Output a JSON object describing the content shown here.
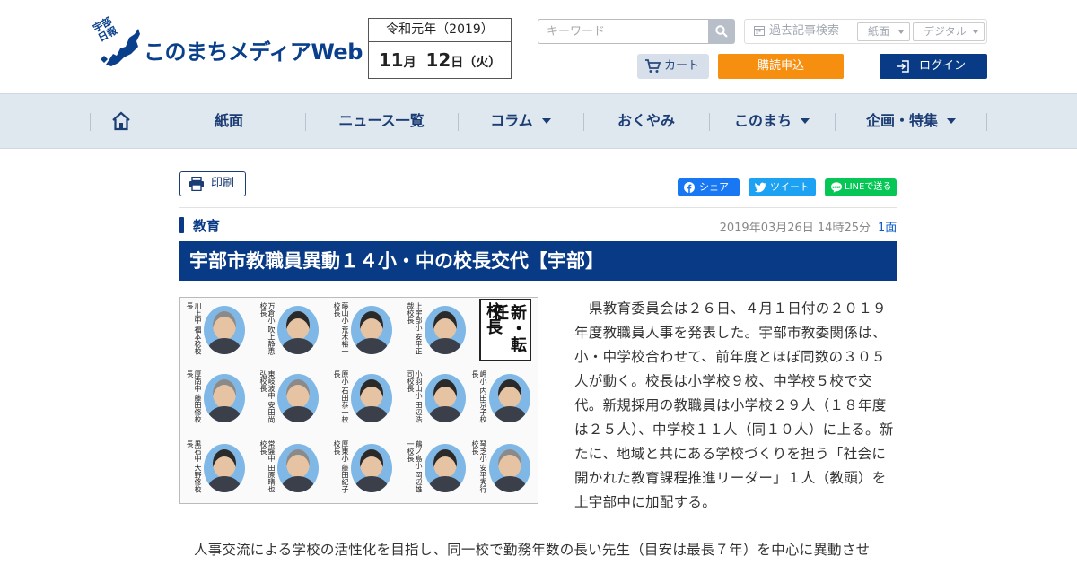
{
  "header": {
    "logo_sub": "宇部日報",
    "logo_text": "このまちメディアWeb",
    "date_era": "令和元年（2019）",
    "month_num": "11",
    "month_unit": "月",
    "day_num": "12",
    "day_unit": "日",
    "weekday": "（火）",
    "search_placeholder": "キーワード",
    "archive_label": "過去記事検索",
    "archive_options": [
      "紙面",
      "デジタル"
    ],
    "cart_label": "カート",
    "subscribe_label": "購読申込",
    "login_label": "ログイン"
  },
  "nav": {
    "items": [
      {
        "label": "紙面",
        "dropdown": false
      },
      {
        "label": "ニュース一覧",
        "dropdown": false
      },
      {
        "label": "コラム",
        "dropdown": true
      },
      {
        "label": "おくやみ",
        "dropdown": false
      },
      {
        "label": "このまち",
        "dropdown": true
      },
      {
        "label": "企画・特集",
        "dropdown": true
      }
    ]
  },
  "article": {
    "print_label": "印刷",
    "share": {
      "facebook": "シェア",
      "twitter": "ツイート",
      "line": "LINEで送る"
    },
    "category": "教育",
    "datetime": "2019年03月26日 14時25分",
    "page": "1面",
    "title": "宇部市教職員異動１４小・中の校長交代【宇部】",
    "photo": {
      "stamp_a": "新・転任",
      "stamp_b": "校長",
      "captions": [
        "上宇部小 安平正哉校長",
        "藤山小 荒木裕一校長",
        "万倉小 吹上静恵校長",
        "川上中 福本稔校長",
        "岬小 内田京子校長",
        "小羽山小 田辺浩司校長",
        "原小 石田恭一校長",
        "東岐波中 安田尚弘校長",
        "厚南中 藤田修校長",
        "琴芝小 安平秀行校長",
        "鵜ノ島小 岡辺雄一校長",
        "厚東小 藤田紀子校長",
        "常盤中 田原晴也校長",
        "黒石中 大野修校長"
      ]
    },
    "body_right": "県教育委員会は２６日、４月１日付の２０１９年度教職員人事を発表した。宇部市教委関係は、小・中学校合わせて、前年度とほぼ同数の３０５人が動く。校長は小学校９校、中学校５校で交代。新規採用の教職員は小学校２９人（１８年度は２５人）、中学校１１人（同１０人）に上る。新たに、地域と共にある学校づくりを担う「社会に開かれた教育課程推進リーダー」１人（教頭）を上宇部中に加配する。",
    "body_bottom": "人事交流による学校の活性化を目指し、同一校で勤務年数の長い先生（目安は最長７年）を中心に異動させ"
  },
  "colors": {
    "brand": "#083a85",
    "accent": "#f68f0f",
    "nav_bg": "#dfe7ef"
  }
}
